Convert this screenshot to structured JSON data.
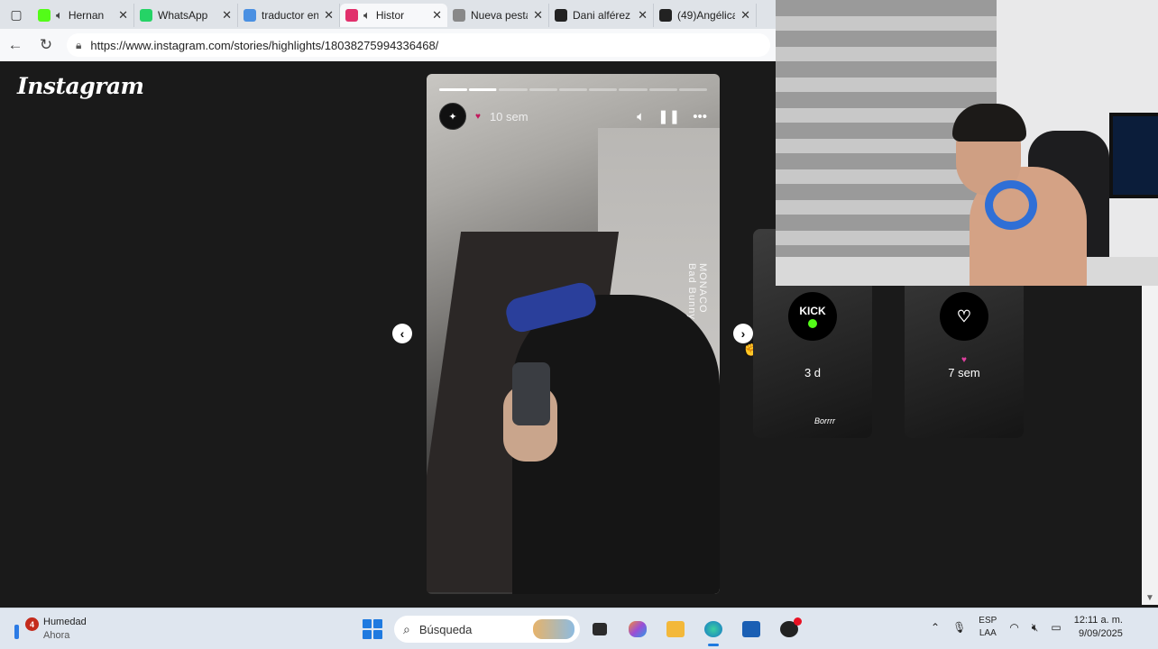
{
  "browser": {
    "tabs": [
      {
        "title": "Hernan",
        "favicon": "kick-icon",
        "color": "#53fc18",
        "audio": true
      },
      {
        "title": "WhatsApp",
        "favicon": "whatsapp-icon",
        "color": "#25d366",
        "audio": false
      },
      {
        "title": "traductor en",
        "favicon": "search-icon",
        "color": "#4a90e2",
        "audio": false
      },
      {
        "title": "Histor",
        "favicon": "instagram-icon",
        "color": "#e1306c",
        "audio": true,
        "active": true
      },
      {
        "title": "Nueva pesta",
        "favicon": "newtab-icon",
        "color": "#888888",
        "audio": false
      },
      {
        "title": "Dani alférez",
        "favicon": "tiktok-icon",
        "color": "#222222",
        "audio": false
      },
      {
        "title": "(49)Angélica",
        "favicon": "tiktok-icon",
        "color": "#222222",
        "audio": false
      }
    ],
    "url": "https://www.instagram.com/stories/highlights/18038275994336468/"
  },
  "instagram": {
    "logo": "Instagram",
    "story": {
      "time": "10 sem",
      "segments": [
        1,
        0.95,
        0,
        0,
        0,
        0,
        0,
        0,
        0
      ],
      "caption_title": "MONACO",
      "caption_artist": "Bad Bunny"
    },
    "next_stories": [
      {
        "avatar_text": "KICK",
        "time": "3 d",
        "bottom_text": "Borrrr"
      },
      {
        "avatar_text": "",
        "time": "7 sem"
      }
    ]
  },
  "taskbar": {
    "weather_label": "Humedad",
    "weather_sub": "Ahora",
    "notif_count": "4",
    "search_placeholder": "Búsqueda",
    "lang_top": "ESP",
    "lang_bottom": "LAA",
    "time": "12:11 a. m.",
    "date": "9/09/2025"
  },
  "colors": {
    "ig_bg": "#1a1a1a",
    "accent": "#1f7ae0"
  }
}
